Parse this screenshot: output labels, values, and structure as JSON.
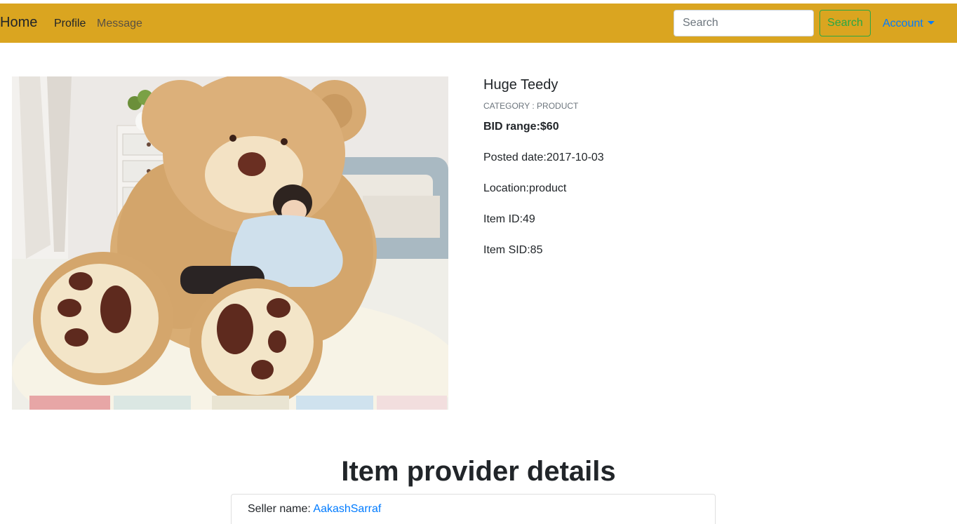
{
  "navbar": {
    "brand": "Home",
    "links": [
      "Profile",
      "Message"
    ],
    "search_placeholder": "Search",
    "search_button": "Search",
    "account_label": "Account",
    "background": "#daa520"
  },
  "product": {
    "title": "Huge Teedy",
    "category": "CATEGORY : PRODUCT",
    "bid_range": "BID range:$60",
    "posted_date": "Posted date:2017-10-03",
    "location": "Location:product",
    "item_id": "Item ID:49",
    "item_sid": "Item SID:85"
  },
  "provider": {
    "heading": "Item provider details",
    "seller_label": "Seller name: ",
    "seller_name": "AakashSarraf"
  },
  "colors": {
    "accent_link": "#007bff",
    "success": "#28a745"
  }
}
